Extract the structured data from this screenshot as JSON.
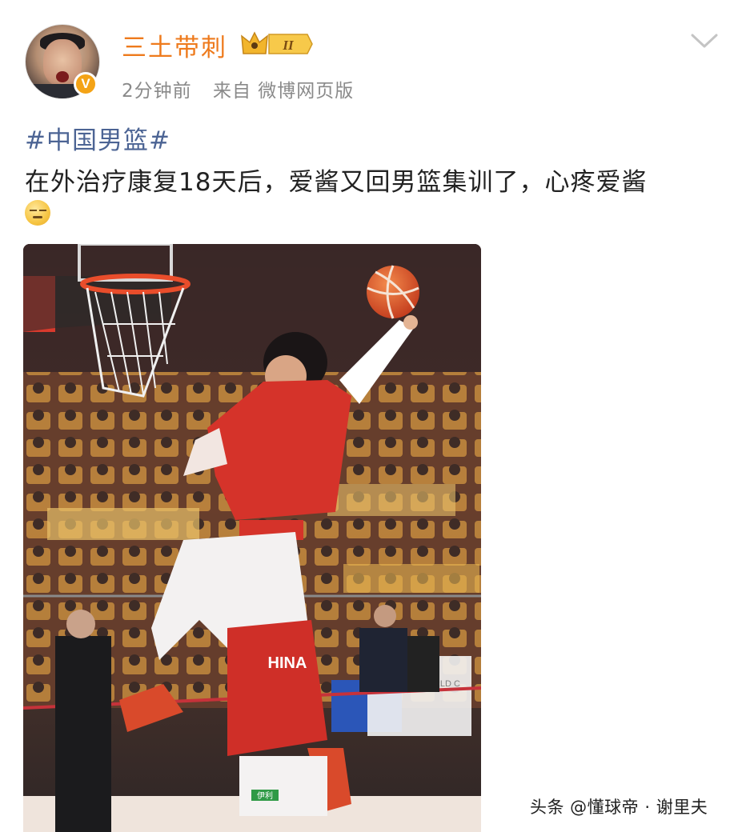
{
  "post": {
    "author": {
      "name": "三土带刺",
      "avatar_icon": "avatar-photo",
      "verified_badge": "V",
      "level_badge": "II"
    },
    "meta": {
      "time": "2分钟前",
      "source": "来自 微博网页版"
    },
    "hashtag": "#中国男篮#",
    "text": "在外治疗康复18天后，爱酱又回男篮集训了，心疼爱酱",
    "emoji_icon": "speechless-face-emoji",
    "photo": {
      "jersey_text": "HINA",
      "banner_text": "WORLD C",
      "shoe_badge_text": "伊利"
    }
  },
  "watermark": "头条 @懂球帝 · 谢里夫",
  "colors": {
    "username": "#ee7a1c",
    "hashtag": "#4c6494",
    "meta": "#8a8a8a",
    "verified": "#f4a316"
  }
}
